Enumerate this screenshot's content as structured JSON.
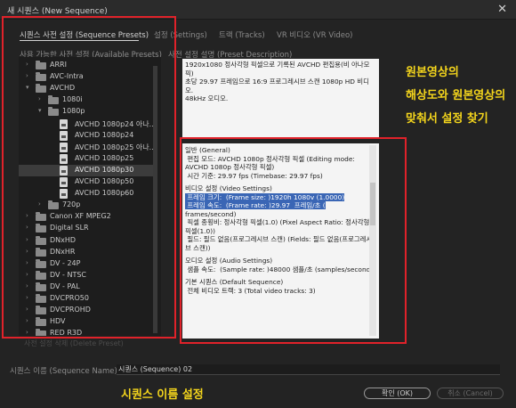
{
  "window": {
    "title": "새 시퀀스 (New Sequence)",
    "close": "✕"
  },
  "tabs": [
    {
      "label": "시퀀스 사전 설정 (Sequence Presets)"
    },
    {
      "label": "설정 (Settings)"
    },
    {
      "label": "트랙 (Tracks)"
    },
    {
      "label": "VR 비디오 (VR Video)"
    }
  ],
  "presets": {
    "heading": "사용 가능한 사전 설정 (Available Presets)",
    "items": [
      {
        "label": "ARRI",
        "type": "folder",
        "expanded": false,
        "level": 0
      },
      {
        "label": "AVC-Intra",
        "type": "folder",
        "expanded": false,
        "level": 0
      },
      {
        "label": "AVCHD",
        "type": "folder",
        "expanded": true,
        "level": 0
      },
      {
        "label": "1080i",
        "type": "folder",
        "expanded": false,
        "level": 1
      },
      {
        "label": "1080p",
        "type": "folder",
        "expanded": true,
        "level": 1
      },
      {
        "label": "AVCHD 1080p24 아나...",
        "type": "file",
        "level": 2
      },
      {
        "label": "AVCHD 1080p24",
        "type": "file",
        "level": 2
      },
      {
        "label": "AVCHD 1080p25 아나...",
        "type": "file",
        "level": 2
      },
      {
        "label": "AVCHD 1080p25",
        "type": "file",
        "level": 2
      },
      {
        "label": "AVCHD 1080p30",
        "type": "file",
        "level": 2,
        "selected": true
      },
      {
        "label": "AVCHD 1080p50",
        "type": "file",
        "level": 2
      },
      {
        "label": "AVCHD 1080p60",
        "type": "file",
        "level": 2
      },
      {
        "label": "720p",
        "type": "folder",
        "expanded": false,
        "level": 1
      },
      {
        "label": "Canon XF MPEG2",
        "type": "folder",
        "expanded": false,
        "level": 0
      },
      {
        "label": "Digital SLR",
        "type": "folder",
        "expanded": false,
        "level": 0
      },
      {
        "label": "DNxHD",
        "type": "folder",
        "expanded": false,
        "level": 0
      },
      {
        "label": "DNxHR",
        "type": "folder",
        "expanded": false,
        "level": 0
      },
      {
        "label": "DV - 24P",
        "type": "folder",
        "expanded": false,
        "level": 0
      },
      {
        "label": "DV - NTSC",
        "type": "folder",
        "expanded": false,
        "level": 0
      },
      {
        "label": "DV - PAL",
        "type": "folder",
        "expanded": false,
        "level": 0
      },
      {
        "label": "DVCPRO50",
        "type": "folder",
        "expanded": false,
        "level": 0
      },
      {
        "label": "DVCPROHD",
        "type": "folder",
        "expanded": false,
        "level": 0
      },
      {
        "label": "HDV",
        "type": "folder",
        "expanded": false,
        "level": 0
      },
      {
        "label": "RED R3D",
        "type": "folder",
        "expanded": false,
        "level": 0
      }
    ],
    "delete_label": "사전 설정 삭제 (Delete Preset)"
  },
  "description": {
    "heading": "사전 설정 설명 (Preset Description)",
    "summary": "1920x1080 정사각형 픽셀으로 기록된 AVCHD 편집용(비 아나모픽)\n초당 29.97 프레임으로 16:9 프로그레시브 스캔 1080p HD 비디오.\n48kHz 오디오.",
    "general_heading": "일반 (General)",
    "editing_mode": " 편집 모드: AVCHD 1080p 정사각형 픽셀 (Editing mode: AVCHD 1080p 정사각형 픽셀)",
    "timebase": " 시간 기준: 29.97 fps (Timebase: 29.97 fps)",
    "video_heading": "비디오 설정 (Video Settings)",
    "frame_size": " 프레임 크기:  (Frame size: )1920h 1080v (1.0000)",
    "frame_rate": " 프레임 속도:  (Frame rate: )29.97  프레임/초 (",
    "frame_rate_cont": "frames/second)",
    "pixel_aspect": " 픽셀 종횡비: 정사각형 픽셀(1.0) (Pixel Aspect Ratio: 정사각형 픽셀(1.0))",
    "fields": " 필드: 필드 없음(프로그레시브 스캔) (Fields: 필드 없음(프로그레시브 스캔))",
    "audio_heading": "오디오 설정 (Audio Settings)",
    "sample_rate": " 샘플 속도:  (Sample rate: )48000 샘플/초 (samples/second)",
    "default_heading": "기본 시퀀스 (Default Sequence)",
    "video_tracks": " 전체 비디오 트랙: 3 (Total video tracks: 3)"
  },
  "annotations": {
    "source_line1": "원본영상의",
    "source_line2": "해상도와 원본영상의",
    "source_line3": "맞춰서 설정 찾기",
    "sequence_name": "시퀀스 이름 설정"
  },
  "sequence_name": {
    "label": "시퀀스 이름 (Sequence Name):",
    "value": "시퀀스 (Sequence) 02"
  },
  "buttons": {
    "ok": "확인 (OK)",
    "cancel": "취소 (Cancel)"
  },
  "colors": {
    "highlight": "#e0222a",
    "annotation": "#f5d61c",
    "selection": "#3a66b5"
  }
}
